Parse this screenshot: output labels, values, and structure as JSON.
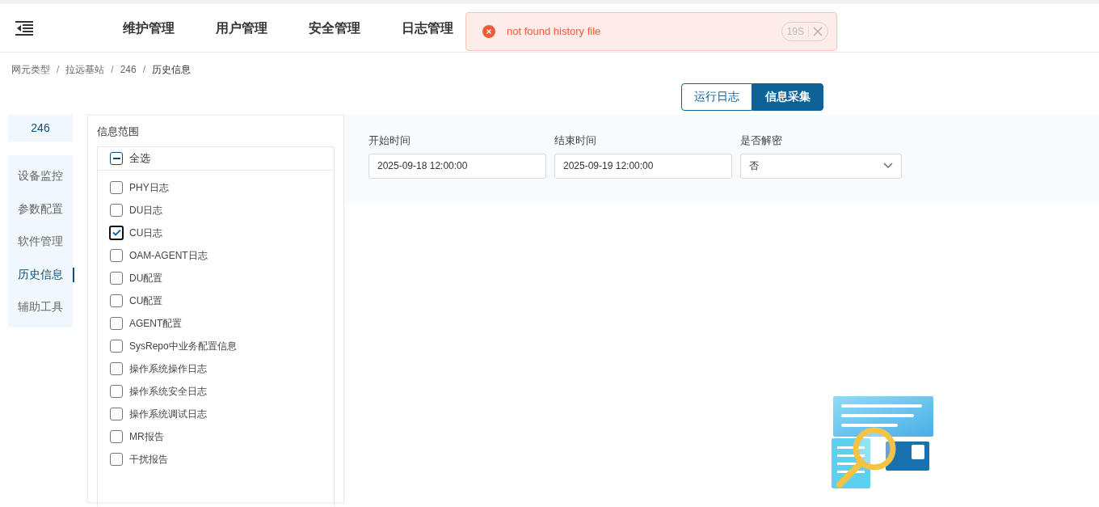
{
  "header": {
    "menu_items": [
      "维护管理",
      "用户管理",
      "安全管理",
      "日志管理"
    ]
  },
  "toast": {
    "message": "not found history file",
    "countdown": "19S"
  },
  "breadcrumb": [
    "网元类型",
    "拉远基站",
    "246",
    "历史信息"
  ],
  "breadcrumb_separator": "/",
  "tabs": [
    {
      "label": "运行日志",
      "selected": false
    },
    {
      "label": "信息采集",
      "selected": true
    }
  ],
  "sidebar": {
    "title": "246",
    "items": [
      {
        "label": "设备监控",
        "selected": false
      },
      {
        "label": "参数配置",
        "selected": false
      },
      {
        "label": "软件管理",
        "selected": false
      },
      {
        "label": "历史信息",
        "selected": true
      },
      {
        "label": "辅助工具",
        "selected": false
      }
    ]
  },
  "scope": {
    "title": "信息范围",
    "select_all": {
      "label": "全选",
      "indeterminate": true
    },
    "items": [
      {
        "label": "PHY日志",
        "checked": false
      },
      {
        "label": "DU日志",
        "checked": false
      },
      {
        "label": "CU日志",
        "checked": true
      },
      {
        "label": "OAM-AGENT日志",
        "checked": false
      },
      {
        "label": "DU配置",
        "checked": false
      },
      {
        "label": "CU配置",
        "checked": false
      },
      {
        "label": "AGENT配置",
        "checked": false
      },
      {
        "label": "SysRepo中业务配置信息",
        "checked": false
      },
      {
        "label": "操作系统操作日志",
        "checked": false
      },
      {
        "label": "操作系统安全日志",
        "checked": false
      },
      {
        "label": "操作系统调试日志",
        "checked": false
      },
      {
        "label": "MR报告",
        "checked": false
      },
      {
        "label": "干扰报告",
        "checked": false
      }
    ]
  },
  "filters": [
    {
      "kind": "input",
      "label": "开始时间",
      "value": "2025-09-18 12:00:00"
    },
    {
      "kind": "input",
      "label": "结束时间",
      "value": "2025-09-19 12:00:00"
    },
    {
      "kind": "select",
      "label": "是否解密",
      "value": "否"
    }
  ]
}
